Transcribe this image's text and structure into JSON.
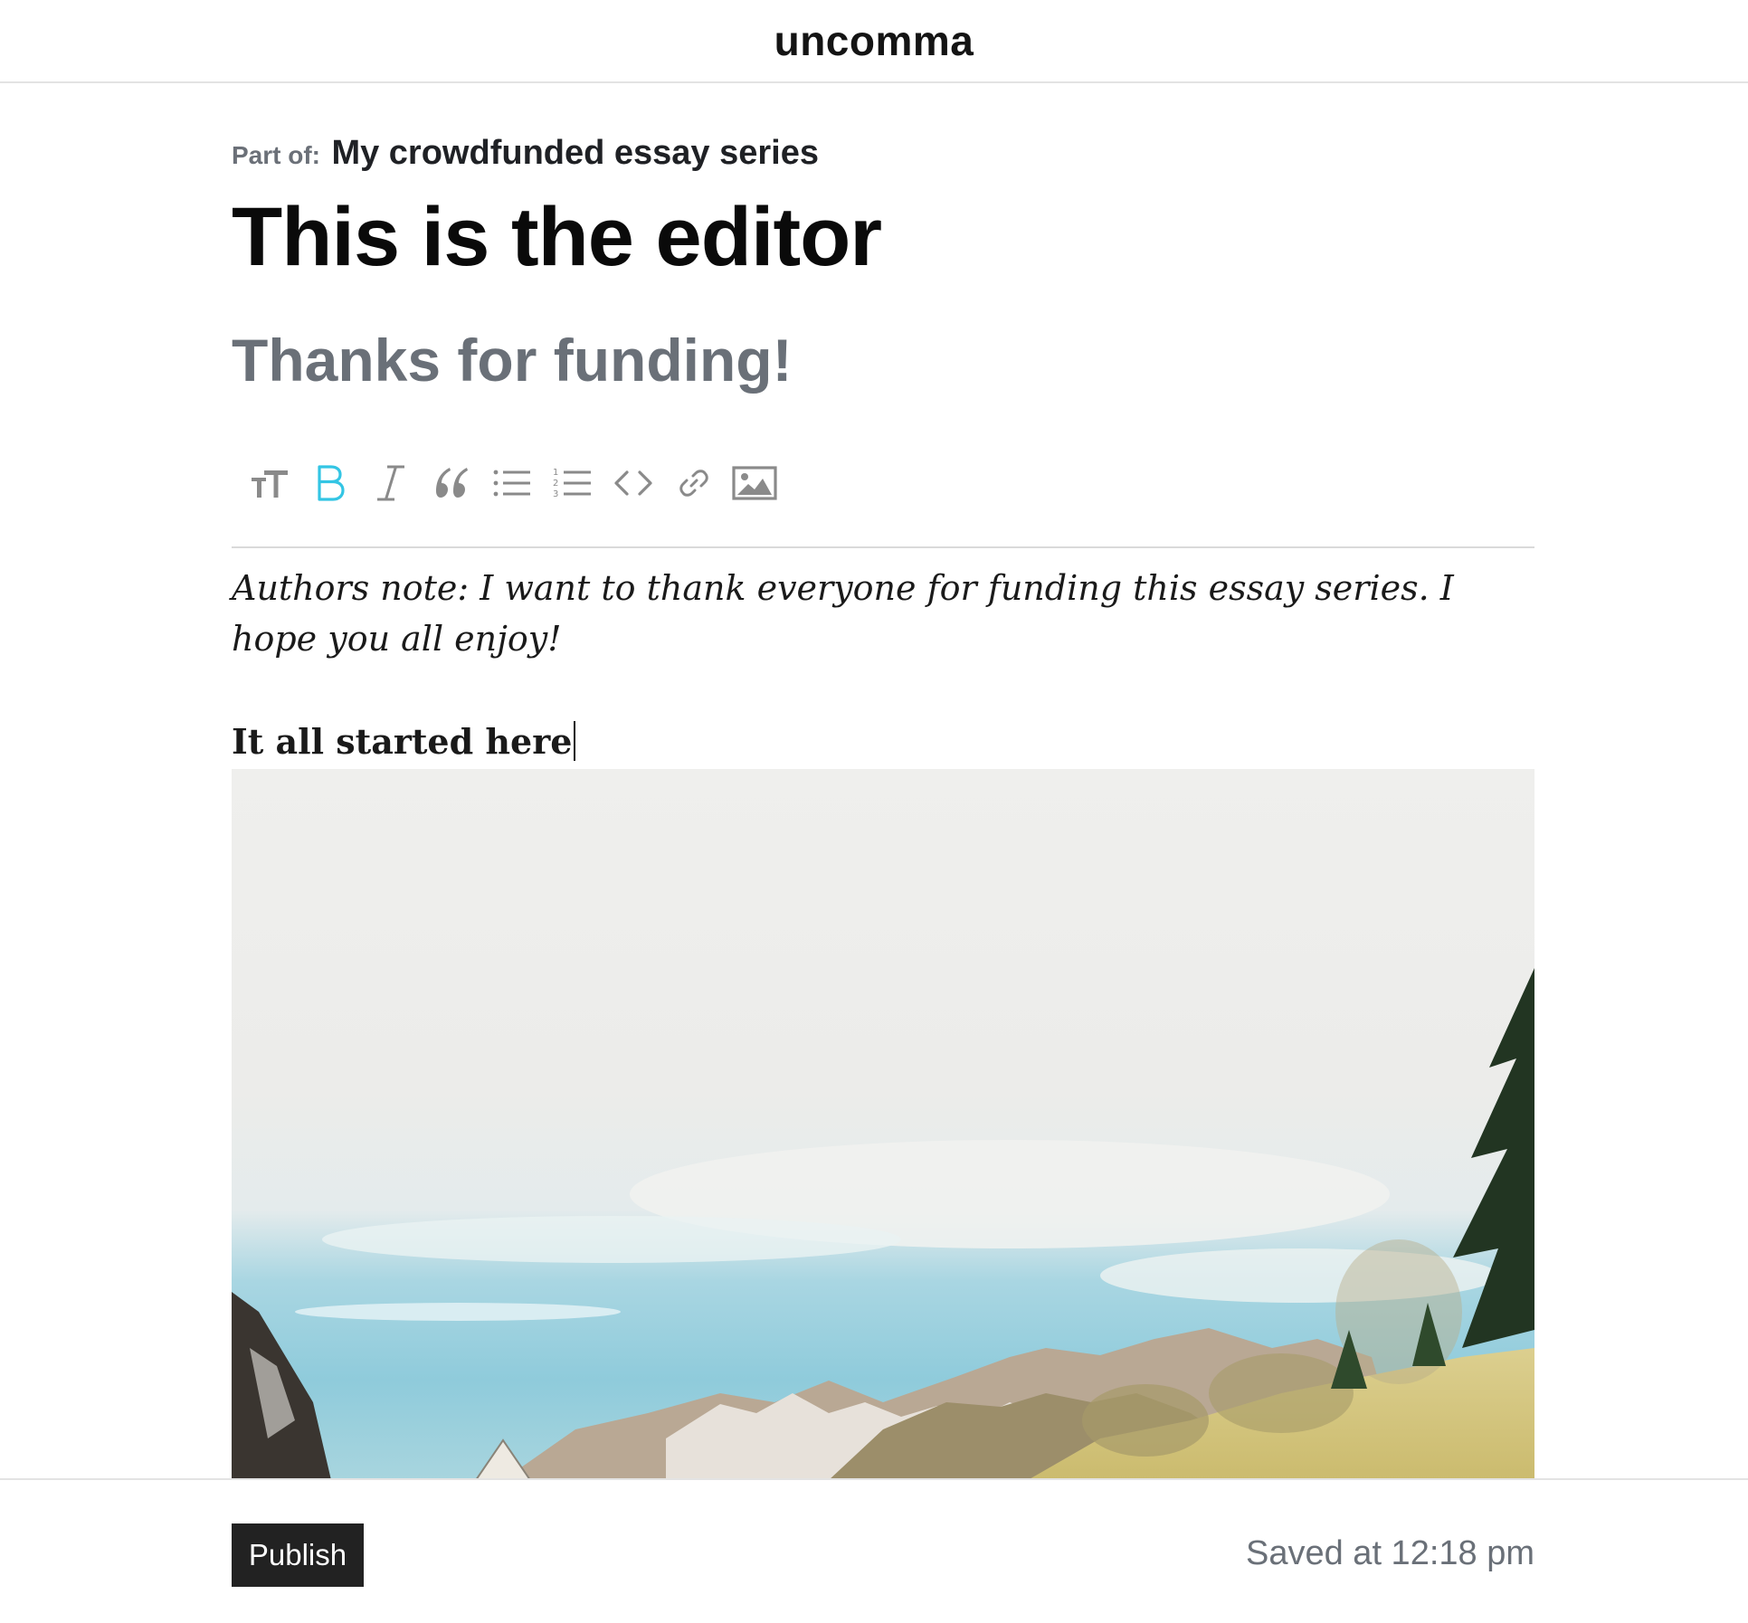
{
  "header": {
    "brand": "uncomma"
  },
  "post": {
    "part_of_label": "Part of:",
    "series_title": "My crowdfunded essay series",
    "title": "This is the editor",
    "subtitle": "Thanks for funding!"
  },
  "toolbar": {
    "active_color": "#33c5e4",
    "tools": [
      {
        "name": "text-size",
        "icon": "text-size-icon",
        "active": false
      },
      {
        "name": "bold",
        "icon": "bold-icon",
        "active": true
      },
      {
        "name": "italic",
        "icon": "italic-icon",
        "active": false
      },
      {
        "name": "quote",
        "icon": "quote-icon",
        "active": false
      },
      {
        "name": "bulleted-list",
        "icon": "bulleted-list-icon",
        "active": false
      },
      {
        "name": "numbered-list",
        "icon": "numbered-list-icon",
        "active": false
      },
      {
        "name": "code",
        "icon": "code-icon",
        "active": false
      },
      {
        "name": "link",
        "icon": "link-icon",
        "active": false
      },
      {
        "name": "image",
        "icon": "image-icon",
        "active": false
      }
    ]
  },
  "content": {
    "note": "Authors note: I want to thank everyone for funding this essay series. I hope you all enjoy!",
    "heading": "It all started here",
    "image_subject": "landscape-photo"
  },
  "footer": {
    "publish_label": "Publish",
    "saved_status": "Saved at 12:18 pm"
  }
}
